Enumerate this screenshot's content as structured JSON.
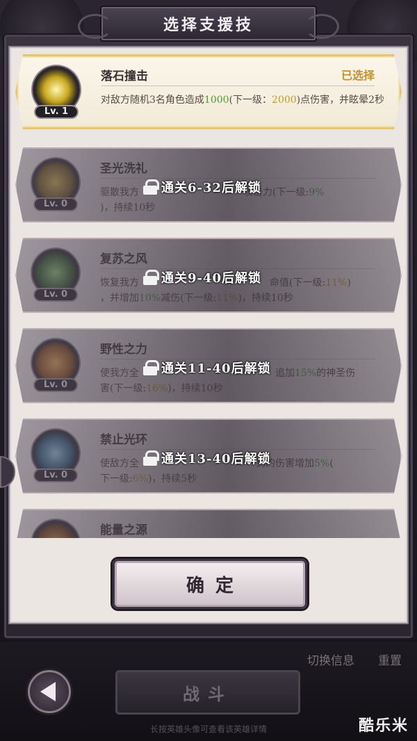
{
  "title": "选择支援技",
  "skills": [
    {
      "name": "落石撞击",
      "level": "Lv. 1",
      "icon": "rock-burst-icon",
      "status": "已选择",
      "desc_parts": [
        "对敌方随机3名角色造成",
        "1000",
        "(下一级：",
        "2000",
        ")点伤害，并眩晕2秒"
      ],
      "lock_text": ""
    },
    {
      "name": "圣光洗礼",
      "level": "Lv. 0",
      "icon": "holy-light-icon",
      "status": "",
      "desc_parts": [
        "驱散我方",
        "",
        "",
        "",
        "攻击力(下一级:",
        "9%",
        ")，持续10秒"
      ],
      "lock_text": "通关6-32后解锁"
    },
    {
      "name": "复苏之风",
      "level": "Lv. 0",
      "icon": "wind-spirit-icon",
      "status": "",
      "desc_parts": [
        "恢复我方",
        "命值(下一级:",
        "11%",
        ")",
        "，并增加",
        "10%",
        "减伤(下一级:",
        "11%",
        ")，持续10秒"
      ],
      "lock_text": "通关9-40后解锁"
    },
    {
      "name": "野性之力",
      "level": "Lv. 0",
      "icon": "beast-icon",
      "status": "",
      "desc_parts": [
        "使我方全",
        "追加",
        "15%",
        "的神圣伤",
        "害(下一级:",
        "16%",
        ")，持续10秒"
      ],
      "lock_text": "通关11-40后解锁"
    },
    {
      "name": "禁止光环",
      "level": "Lv. 0",
      "icon": "crystal-ward-icon",
      "status": "",
      "desc_parts": [
        "使敌方全",
        "到的伤害增加",
        "5%",
        "(",
        "下一级:",
        "6%",
        ")，持续5秒"
      ],
      "lock_text": "通关13-40后解锁"
    },
    {
      "name": "能量之源",
      "level": "",
      "icon": "energy-icon",
      "status": "",
      "desc_parts": [],
      "lock_text": ""
    }
  ],
  "confirm_label": "确定",
  "footer": {
    "switch_info": "切换信息",
    "reset": "重置",
    "battle": "战斗",
    "hint": "长按英雄头像可查看该英雄详情"
  },
  "watermark": "酷乐米",
  "colors": {
    "highlight_green": "#47a02d",
    "highlight_gold": "#c09a25",
    "selected_border": "#e7c37a"
  }
}
